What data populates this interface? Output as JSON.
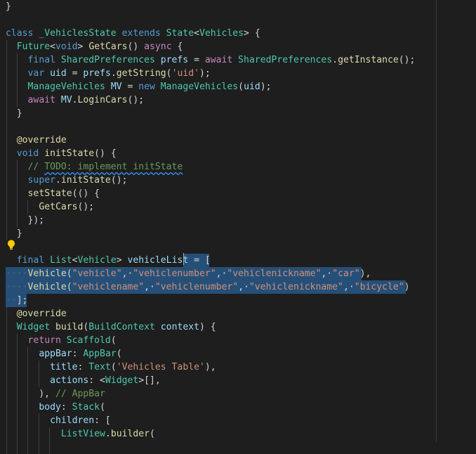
{
  "editor": {
    "theme": "dark",
    "colors": {
      "background": "#1e1e1e",
      "selection": "#264f78",
      "keyword": "#569cd6",
      "control": "#c586c0",
      "type": "#4ec9b0",
      "function": "#dcdcaa",
      "variable": "#9cdcfe",
      "string": "#ce9178",
      "comment": "#6a9955"
    },
    "gutter_icon": "lightbulb-icon",
    "lines": [
      [
        [
          "t-pl",
          "}"
        ]
      ],
      [],
      [
        [
          "t-kw",
          "class"
        ],
        [
          "t-pl",
          " "
        ],
        [
          "t-ty",
          "_VehiclesState"
        ],
        [
          "t-pl",
          " "
        ],
        [
          "t-kw",
          "extends"
        ],
        [
          "t-pl",
          " "
        ],
        [
          "t-ty",
          "State"
        ],
        [
          "t-pl",
          "<"
        ],
        [
          "t-ty",
          "Vehicles"
        ],
        [
          "t-pl",
          "> {"
        ]
      ],
      [
        [
          "t-pl",
          "  "
        ],
        [
          "t-ty",
          "Future"
        ],
        [
          "t-pl",
          "<"
        ],
        [
          "t-kw",
          "void"
        ],
        [
          "t-pl",
          "> "
        ],
        [
          "t-fn",
          "GetCars"
        ],
        [
          "t-pl",
          "() "
        ],
        [
          "t-ctl",
          "async"
        ],
        [
          "t-pl",
          " {"
        ]
      ],
      [
        [
          "t-pl",
          "    "
        ],
        [
          "t-kw",
          "final"
        ],
        [
          "t-pl",
          " "
        ],
        [
          "t-ty",
          "SharedPreferences"
        ],
        [
          "t-pl",
          " "
        ],
        [
          "t-var",
          "prefs"
        ],
        [
          "t-pl",
          " = "
        ],
        [
          "t-ctl",
          "await"
        ],
        [
          "t-pl",
          " "
        ],
        [
          "t-ty",
          "SharedPreferences"
        ],
        [
          "t-pl",
          "."
        ],
        [
          "t-fn",
          "getInstance"
        ],
        [
          "t-pl",
          "();"
        ]
      ],
      [
        [
          "t-pl",
          "    "
        ],
        [
          "t-kw",
          "var"
        ],
        [
          "t-pl",
          " "
        ],
        [
          "t-var",
          "uid"
        ],
        [
          "t-pl",
          " = "
        ],
        [
          "t-var",
          "prefs"
        ],
        [
          "t-pl",
          "."
        ],
        [
          "t-fn",
          "getString"
        ],
        [
          "t-pl",
          "("
        ],
        [
          "t-str",
          "'uid'"
        ],
        [
          "t-pl",
          ");"
        ]
      ],
      [
        [
          "t-pl",
          "    "
        ],
        [
          "t-ty",
          "ManageVehicles"
        ],
        [
          "t-pl",
          " "
        ],
        [
          "t-var",
          "MV"
        ],
        [
          "t-pl",
          " = "
        ],
        [
          "t-kw",
          "new"
        ],
        [
          "t-pl",
          " "
        ],
        [
          "t-ty",
          "ManageVehicles"
        ],
        [
          "t-pl",
          "("
        ],
        [
          "t-var",
          "uid"
        ],
        [
          "t-pl",
          ");"
        ]
      ],
      [
        [
          "t-pl",
          "    "
        ],
        [
          "t-ctl",
          "await"
        ],
        [
          "t-pl",
          " "
        ],
        [
          "t-var",
          "MV"
        ],
        [
          "t-pl",
          "."
        ],
        [
          "t-fn",
          "LoginCars"
        ],
        [
          "t-pl",
          "();"
        ]
      ],
      [
        [
          "t-pl",
          "  }"
        ]
      ],
      [],
      [
        [
          "t-pl",
          "  "
        ],
        [
          "t-fn",
          "@override"
        ]
      ],
      [
        [
          "t-pl",
          "  "
        ],
        [
          "t-kw",
          "void"
        ],
        [
          "t-pl",
          " "
        ],
        [
          "t-fn",
          "initState"
        ],
        [
          "t-pl",
          "() {"
        ]
      ],
      [
        [
          "t-pl",
          "    "
        ],
        [
          "t-com",
          "// "
        ],
        [
          "t-todo",
          "TODO: implement initState"
        ]
      ],
      [
        [
          "t-pl",
          "    "
        ],
        [
          "t-kw",
          "super"
        ],
        [
          "t-pl",
          "."
        ],
        [
          "t-fn",
          "initState"
        ],
        [
          "t-pl",
          "();"
        ]
      ],
      [
        [
          "t-pl",
          "    "
        ],
        [
          "t-fn",
          "setState"
        ],
        [
          "t-pl",
          "(() {"
        ]
      ],
      [
        [
          "t-pl",
          "      "
        ],
        [
          "t-fn",
          "GetCars"
        ],
        [
          "t-pl",
          "();"
        ]
      ],
      [
        [
          "t-pl",
          "    });"
        ]
      ],
      [
        [
          "t-pl",
          "  }"
        ]
      ],
      [],
      [
        [
          "t-pl",
          "  "
        ],
        [
          "t-kw",
          "final"
        ],
        [
          "t-pl",
          " "
        ],
        [
          "t-ty",
          "List"
        ],
        [
          "t-pl",
          "<"
        ],
        [
          "t-ty",
          "Vehicle"
        ],
        [
          "t-pl",
          "> "
        ],
        [
          "t-var",
          "vehicleList"
        ],
        [
          "t-pl",
          " = ["
        ]
      ],
      [
        [
          "ws",
          "····"
        ],
        [
          "t-fn",
          "Vehicle"
        ],
        [
          "t-pl",
          "("
        ],
        [
          "t-str",
          "\"vehicle\""
        ],
        [
          "t-pl",
          ",·"
        ],
        [
          "t-str",
          "\"vehiclenumber\""
        ],
        [
          "t-pl",
          ",·"
        ],
        [
          "t-str",
          "\"vehiclenickname\""
        ],
        [
          "t-pl",
          ",·"
        ],
        [
          "t-str",
          "\"car\""
        ],
        [
          "t-pl",
          "),"
        ]
      ],
      [
        [
          "ws",
          "····"
        ],
        [
          "t-fn",
          "Vehicle"
        ],
        [
          "t-pl",
          "("
        ],
        [
          "t-str",
          "\"vehiclename\""
        ],
        [
          "t-pl",
          ",·"
        ],
        [
          "t-str",
          "\"vehiclenumber\""
        ],
        [
          "t-pl",
          ",·"
        ],
        [
          "t-str",
          "\"vehiclenickname\""
        ],
        [
          "t-pl",
          ",·"
        ],
        [
          "t-str",
          "\"bicycle\""
        ],
        [
          "t-pl",
          ")"
        ]
      ],
      [
        [
          "ws",
          "··"
        ],
        [
          "t-pl",
          "];"
        ]
      ],
      [
        [
          "t-pl",
          "  "
        ],
        [
          "t-fn",
          "@override"
        ]
      ],
      [
        [
          "t-pl",
          "  "
        ],
        [
          "t-ty",
          "Widget"
        ],
        [
          "t-pl",
          " "
        ],
        [
          "t-fn",
          "build"
        ],
        [
          "t-pl",
          "("
        ],
        [
          "t-ty",
          "BuildContext"
        ],
        [
          "t-pl",
          " "
        ],
        [
          "t-var",
          "context"
        ],
        [
          "t-pl",
          ") {"
        ]
      ],
      [
        [
          "t-pl",
          "    "
        ],
        [
          "t-ctl",
          "return"
        ],
        [
          "t-pl",
          " "
        ],
        [
          "t-ty",
          "Scaffold"
        ],
        [
          "t-pl",
          "("
        ]
      ],
      [
        [
          "t-pl",
          "      "
        ],
        [
          "t-var",
          "appBar"
        ],
        [
          "t-pl",
          ": "
        ],
        [
          "t-ty",
          "AppBar"
        ],
        [
          "t-pl",
          "("
        ]
      ],
      [
        [
          "t-pl",
          "        "
        ],
        [
          "t-var",
          "title"
        ],
        [
          "t-pl",
          ": "
        ],
        [
          "t-ty",
          "Text"
        ],
        [
          "t-pl",
          "("
        ],
        [
          "t-str",
          "'Vehicles Table'"
        ],
        [
          "t-pl",
          "),"
        ]
      ],
      [
        [
          "t-pl",
          "        "
        ],
        [
          "t-var",
          "actions"
        ],
        [
          "t-pl",
          ": <"
        ],
        [
          "t-ty",
          "Widget"
        ],
        [
          "t-pl",
          ">[],"
        ]
      ],
      [
        [
          "t-pl",
          "      ), "
        ],
        [
          "t-com",
          "// AppBar"
        ]
      ],
      [
        [
          "t-pl",
          "      "
        ],
        [
          "t-var",
          "body"
        ],
        [
          "t-pl",
          ": "
        ],
        [
          "t-ty",
          "Stack"
        ],
        [
          "t-pl",
          "("
        ]
      ],
      [
        [
          "t-pl",
          "        "
        ],
        [
          "t-var",
          "children"
        ],
        [
          "t-pl",
          ": ["
        ]
      ],
      [
        [
          "t-pl",
          "          "
        ],
        [
          "t-ty",
          "ListView"
        ],
        [
          "t-pl",
          "."
        ],
        [
          "t-fn",
          "builder"
        ],
        [
          "t-pl",
          "("
        ]
      ]
    ]
  }
}
